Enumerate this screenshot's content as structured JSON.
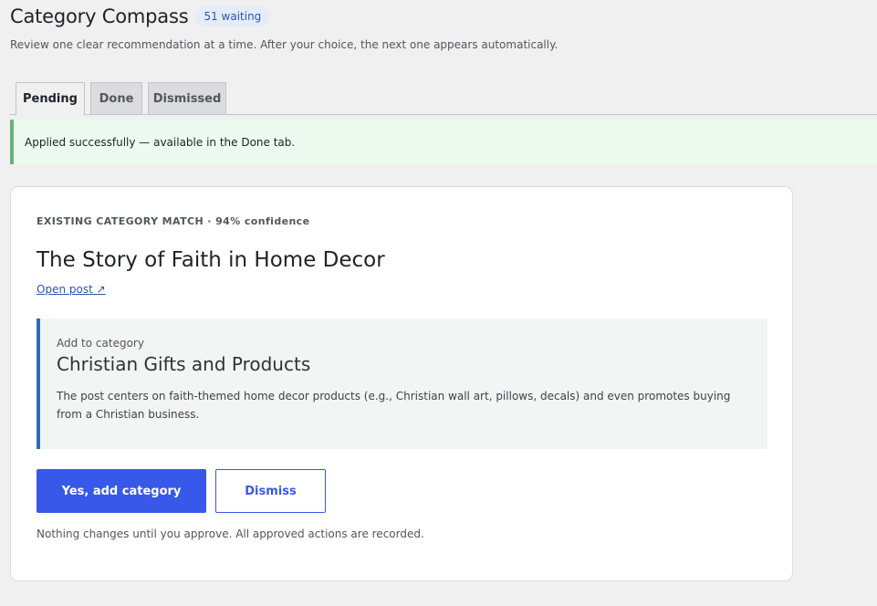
{
  "header": {
    "title": "Category Compass",
    "badge": "51 waiting",
    "subtitle": "Review one clear recommendation at a time. After your choice, the next one appears automatically."
  },
  "tabs": [
    {
      "label": "Pending",
      "active": true
    },
    {
      "label": "Done",
      "active": false
    },
    {
      "label": "Dismissed",
      "active": false
    }
  ],
  "notice": {
    "text": "Applied successfully — available in the Done tab."
  },
  "card": {
    "eyebrow": "EXISTING CATEGORY MATCH · 94% confidence",
    "post_title": "The Story of Faith in Home Decor",
    "open_link": "Open post ↗",
    "recommendation": {
      "label": "Add to category",
      "category": "Christian Gifts and Products",
      "description": "The post centers on faith-themed home decor products (e.g., Christian wall art, pillows, decals) and even promotes buying from a Christian business."
    },
    "primary_label": "Yes, add category",
    "secondary_label": "Dismiss",
    "footnote": "Nothing changes until you approve. All approved actions are recorded."
  },
  "colors": {
    "primary": "#3858e9",
    "success_border": "#68b37a",
    "rec_border": "#2a6eb0"
  }
}
